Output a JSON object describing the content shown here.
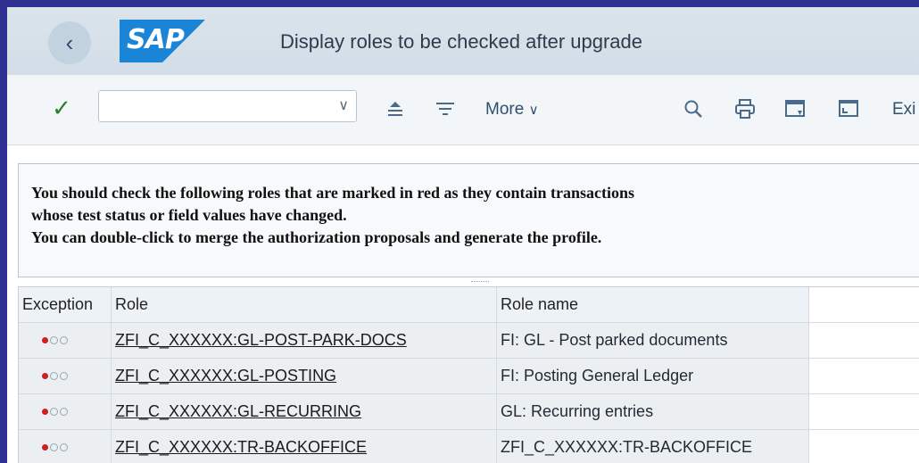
{
  "header": {
    "logo_text": "SAP",
    "title": "Display roles to be checked after upgrade",
    "back_icon": "chevron-left-icon"
  },
  "toolbar": {
    "command_value": "",
    "more_label": "More",
    "exit_label": "Exi",
    "icons": [
      "check-icon",
      "collapse-icon",
      "filter-icon",
      "search-icon",
      "print-icon",
      "window-icon",
      "window-alt-icon"
    ]
  },
  "message": {
    "line1": "You should check the following roles that are marked in red as they contain transactions",
    "line2": "whose test status or field values have changed.",
    "line3": "You can double-click to merge the authorization proposals and generate the profile."
  },
  "table": {
    "headers": [
      "Exception",
      "Role",
      "Role name"
    ],
    "rows": [
      {
        "exception": "red",
        "role": "ZFI_C_XXXXXX:GL-POST-PARK-DOCS",
        "name": "FI: GL - Post parked documents"
      },
      {
        "exception": "red",
        "role": "ZFI_C_XXXXXX:GL-POSTING",
        "name": "FI: Posting General Ledger"
      },
      {
        "exception": "red",
        "role": "ZFI_C_XXXXXX:GL-RECURRING",
        "name": "GL: Recurring entries"
      },
      {
        "exception": "red",
        "role": "ZFI_C_XXXXXX:TR-BACKOFFICE",
        "name": "ZFI_C_XXXXXX:TR-BACKOFFICE"
      }
    ]
  },
  "colors": {
    "frame": "#2e3192",
    "logo_blue": "#1a85d6",
    "status_red": "#cc1f1f",
    "check_green": "#2b7d2b"
  }
}
